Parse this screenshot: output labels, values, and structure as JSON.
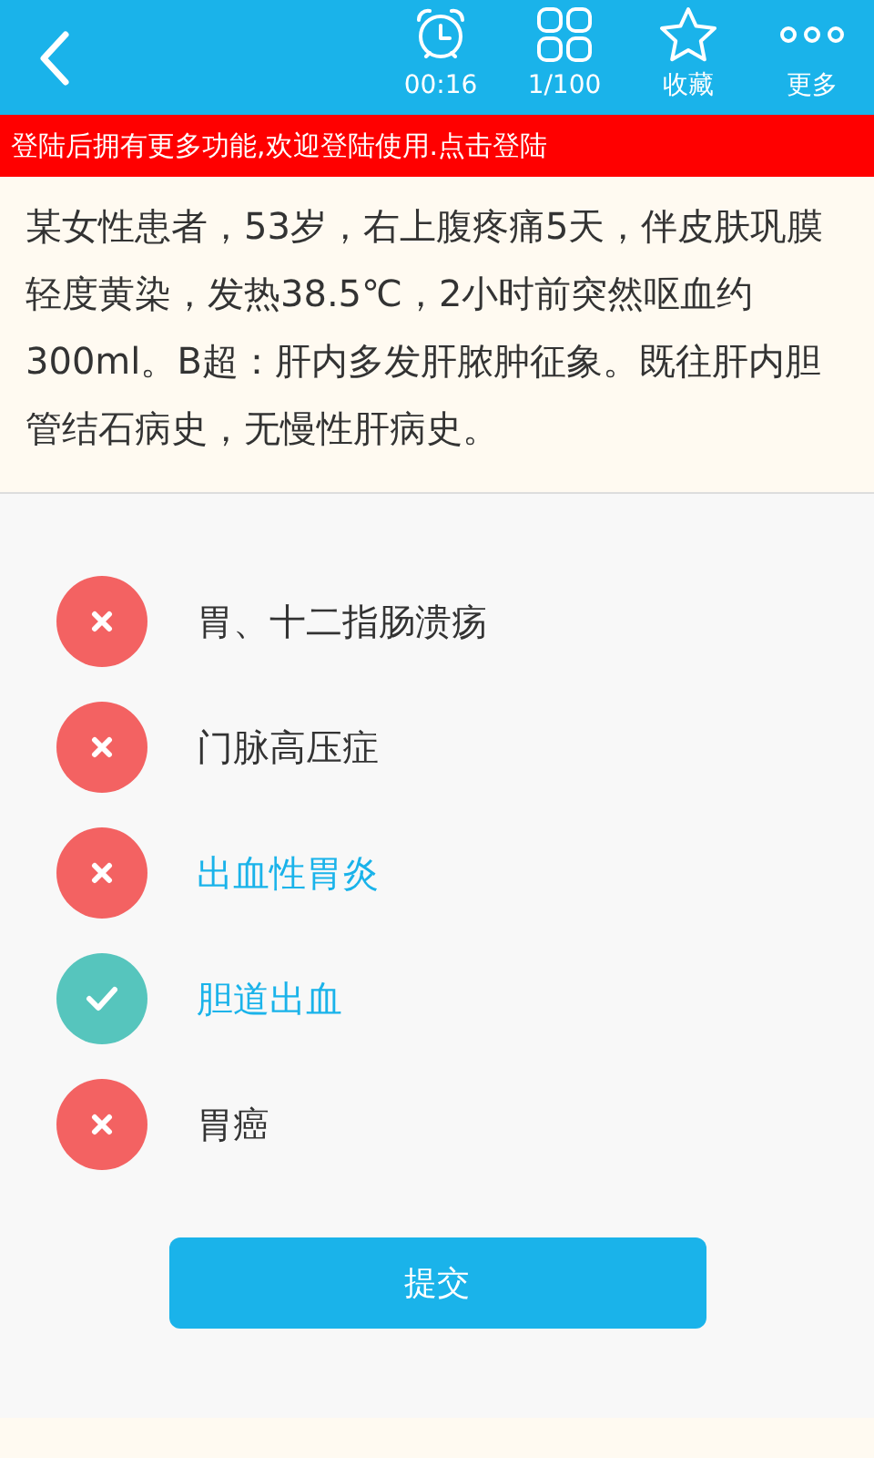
{
  "toolbar": {
    "items": [
      {
        "kind": "timer",
        "label": "00:16"
      },
      {
        "kind": "grid",
        "label": "1/100"
      },
      {
        "kind": "star",
        "label": "收藏"
      },
      {
        "kind": "more",
        "label": "更多"
      }
    ]
  },
  "login_banner": {
    "text": "登陆后拥有更多功能,欢迎登陆使用.点击登陆"
  },
  "question": {
    "text": "某女性患者，53岁，右上腹疼痛5天，伴皮肤巩膜轻度黄染，发热38.5℃，2小时前突然呕血约300ml。B超：肝内多发肝脓肿征象。既往肝内胆管结石病史，无慢性肝病史。"
  },
  "options": [
    {
      "label": "胃、十二指肠溃疡",
      "kind": "wrong",
      "selected": false
    },
    {
      "label": "门脉高压症",
      "kind": "wrong",
      "selected": false
    },
    {
      "label": "出血性胃炎",
      "kind": "wrong",
      "selected": true
    },
    {
      "label": "胆道出血",
      "kind": "correct",
      "selected": true
    },
    {
      "label": "胃癌",
      "kind": "wrong",
      "selected": false
    }
  ],
  "submit_button": {
    "label": "提交"
  }
}
